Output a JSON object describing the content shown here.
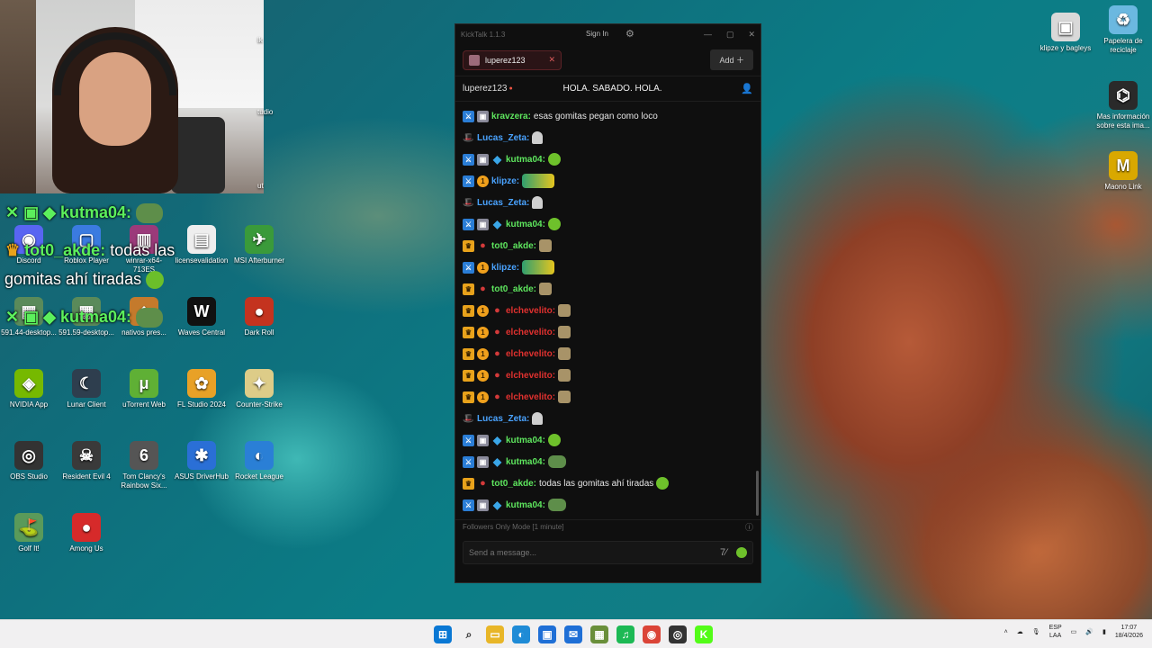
{
  "desktop": {
    "icons": [
      {
        "label": "klipze y bagleys",
        "glyph": "▣",
        "color": "#d9d9d9"
      },
      {
        "label": "Papelera de reciclaje",
        "glyph": "♻",
        "color": "#6bb8e0"
      },
      {
        "label": "Mas información sobre esta ima...",
        "glyph": "⌬",
        "color": "#2a2a2a"
      },
      {
        "label": "Maono Link",
        "glyph": "M",
        "color": "#d9a800"
      },
      {
        "label": "Discord",
        "glyph": "◉",
        "color": "#5865f2"
      },
      {
        "label": "Roblox Player",
        "glyph": "▢",
        "color": "#3b7be0"
      },
      {
        "label": "winrar-x64-713ES",
        "glyph": "▥",
        "color": "#9b3a7a"
      },
      {
        "label": "licensevalidation",
        "glyph": "▤",
        "color": "#eeeeee"
      },
      {
        "label": "MSI Afterburner",
        "glyph": "✈",
        "color": "#3a9a3a"
      },
      {
        "label": "591.44-desktop...",
        "glyph": "▦",
        "color": "#5a8a5a"
      },
      {
        "label": "591.59-desktop...",
        "glyph": "▦",
        "color": "#5a8a5a"
      },
      {
        "label": "nativos pres...",
        "glyph": "◆",
        "color": "#c47a2c"
      },
      {
        "label": "Waves Central",
        "glyph": "W",
        "color": "#111111"
      },
      {
        "label": "Dark Roll",
        "glyph": "●",
        "color": "#c4331f"
      },
      {
        "label": "NVIDIA App",
        "glyph": "◈",
        "color": "#76b900"
      },
      {
        "label": "Lunar Client",
        "glyph": "☾",
        "color": "#2e3e4e"
      },
      {
        "label": "uTorrent Web",
        "glyph": "μ",
        "color": "#5fb035"
      },
      {
        "label": "FL Studio 2024",
        "glyph": "✿",
        "color": "#e8a127"
      },
      {
        "label": "Counter-Strike",
        "glyph": "✦",
        "color": "#ddcc88"
      },
      {
        "label": "OBS Studio",
        "glyph": "◎",
        "color": "#333333"
      },
      {
        "label": "Resident Evil 4",
        "glyph": "☠",
        "color": "#3a3a3a"
      },
      {
        "label": "Tom Clancy's Rainbow Six...",
        "glyph": "6",
        "color": "#555555"
      },
      {
        "label": "ASUS DriverHub",
        "glyph": "✱",
        "color": "#2a6fd6"
      },
      {
        "label": "Rocket League",
        "glyph": "◐",
        "color": "#2a7fd6"
      },
      {
        "label": "Golf It!",
        "glyph": "⛳",
        "color": "#5a9a5a"
      },
      {
        "label": "Among Us",
        "glyph": "●",
        "color": "#d62a2a"
      }
    ],
    "partial_labels": [
      "lk",
      "tudio",
      "ut"
    ]
  },
  "overlay_chat": {
    "line1_name": "kutma04:",
    "line2_name": "tot0_akde:",
    "line2_text": "todas las",
    "line3_text": "gomitas ahí tiradas",
    "line4_name": "kutma04:"
  },
  "kicktalk": {
    "title": "KickTalk 1.1.3",
    "sign_in": "Sign In",
    "tab_channel": "luperez123",
    "add_label": "Add",
    "stream_channel": "luperez123",
    "stream_title": "HOLA. SABADO. HOLA.",
    "followers_mode": "Followers Only Mode [1 minute]",
    "input_placeholder": "Send a message...",
    "messages": [
      {
        "badges": [
          "sword",
          "box"
        ],
        "user": "kravzera:",
        "color": "#5ee65e",
        "text": "esas gomitas pegan como loco",
        "emote": ""
      },
      {
        "badges": [
          "hat"
        ],
        "user": "Lucas_Zeta:",
        "color": "#4aa3ff",
        "text": "",
        "emote": "ghost"
      },
      {
        "badges": [
          "sword",
          "box",
          "cube"
        ],
        "user": "kutma04:",
        "color": "#5ee65e",
        "text": "",
        "emote": "g"
      },
      {
        "badges": [
          "sword",
          "one"
        ],
        "user": "klipze:",
        "color": "#4aa3ff",
        "text": "",
        "emote": "gold"
      },
      {
        "badges": [
          "hat"
        ],
        "user": "Lucas_Zeta:",
        "color": "#4aa3ff",
        "text": "",
        "emote": "ghost"
      },
      {
        "badges": [
          "sword",
          "box",
          "cube"
        ],
        "user": "kutma04:",
        "color": "#5ee65e",
        "text": "",
        "emote": "g"
      },
      {
        "badges": [
          "crown",
          "red"
        ],
        "user": "tot0_akde:",
        "color": "#5ee65e",
        "text": "",
        "emote": "face"
      },
      {
        "badges": [
          "sword",
          "one"
        ],
        "user": "klipze:",
        "color": "#4aa3ff",
        "text": "",
        "emote": "gold"
      },
      {
        "badges": [
          "crown",
          "red"
        ],
        "user": "tot0_akde:",
        "color": "#5ee65e",
        "text": "",
        "emote": "face"
      },
      {
        "badges": [
          "crown",
          "one",
          "red"
        ],
        "user": "elchevelito:",
        "color": "#e0312f",
        "text": "",
        "emote": "face"
      },
      {
        "badges": [
          "crown",
          "one",
          "red"
        ],
        "user": "elchevelito:",
        "color": "#e0312f",
        "text": "",
        "emote": "face"
      },
      {
        "badges": [
          "crown",
          "one",
          "red"
        ],
        "user": "elchevelito:",
        "color": "#e0312f",
        "text": "",
        "emote": "face"
      },
      {
        "badges": [
          "crown",
          "one",
          "red"
        ],
        "user": "elchevelito:",
        "color": "#e0312f",
        "text": "",
        "emote": "face"
      },
      {
        "badges": [
          "crown",
          "one",
          "red"
        ],
        "user": "elchevelito:",
        "color": "#e0312f",
        "text": "",
        "emote": "face"
      },
      {
        "badges": [
          "hat"
        ],
        "user": "Lucas_Zeta:",
        "color": "#4aa3ff",
        "text": "",
        "emote": "ghost"
      },
      {
        "badges": [
          "sword",
          "box",
          "cube"
        ],
        "user": "kutma04:",
        "color": "#5ee65e",
        "text": "",
        "emote": "g"
      },
      {
        "badges": [
          "sword",
          "box",
          "cube"
        ],
        "user": "kutma04:",
        "color": "#5ee65e",
        "text": "",
        "emote": "frog"
      },
      {
        "badges": [
          "crown",
          "red"
        ],
        "user": "tot0_akde:",
        "color": "#5ee65e",
        "text": "todas las gomitas ahí tiradas",
        "emote": "g"
      },
      {
        "badges": [
          "sword",
          "box",
          "cube"
        ],
        "user": "kutma04:",
        "color": "#5ee65e",
        "text": "",
        "emote": "frog"
      }
    ]
  },
  "taskbar": {
    "icons": [
      {
        "name": "start",
        "glyph": "⊞",
        "color": "#0a78d4"
      },
      {
        "name": "search",
        "glyph": "⌕",
        "color": "#444444"
      },
      {
        "name": "file-explorer",
        "glyph": "▭",
        "color": "#e8b628"
      },
      {
        "name": "edge",
        "glyph": "◐",
        "color": "#1f8bd6"
      },
      {
        "name": "store",
        "glyph": "▣",
        "color": "#1f6fd6"
      },
      {
        "name": "outlook",
        "glyph": "✉",
        "color": "#1f6fd6"
      },
      {
        "name": "minecraft",
        "glyph": "▦",
        "color": "#6a8f3a"
      },
      {
        "name": "spotify",
        "glyph": "♫",
        "color": "#1db954"
      },
      {
        "name": "chrome",
        "glyph": "◉",
        "color": "#db4437"
      },
      {
        "name": "obs",
        "glyph": "◎",
        "color": "#333333"
      },
      {
        "name": "kick",
        "glyph": "K",
        "color": "#53fc18"
      }
    ],
    "lang_top": "ESP",
    "lang_bottom": "LAA",
    "time": "17:07",
    "date": "18/4/2026"
  }
}
